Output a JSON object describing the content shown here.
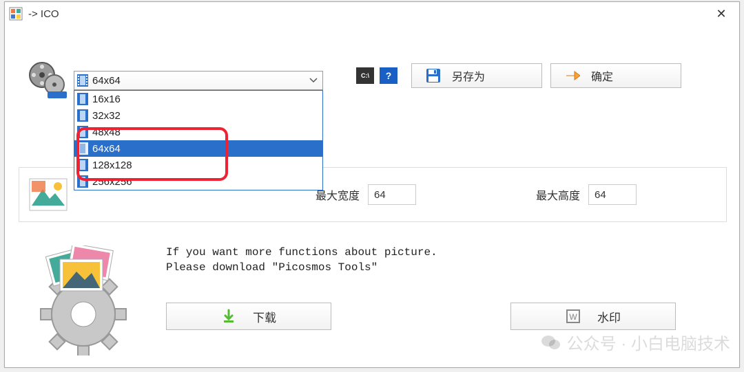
{
  "window": {
    "title": "-> ICO",
    "close_glyph": "✕"
  },
  "combo": {
    "selected": "64x64",
    "options": [
      "16x16",
      "32x32",
      "48x48",
      "64x64",
      "128x128",
      "256x256"
    ],
    "highlight_index": 3
  },
  "buttons": {
    "save_as": "另存为",
    "ok": "确定",
    "download": "下载",
    "watermark": "水印"
  },
  "dims": {
    "max_width_label": "最大宽度",
    "max_width_value": "64",
    "max_height_label": "最大高度",
    "max_height_value": "64"
  },
  "promo": {
    "line1": "If you want more functions about picture.",
    "line2": "Please download \"Picosmos Tools\""
  },
  "watermark": {
    "text": "公众号 · 小白电脑技术"
  }
}
